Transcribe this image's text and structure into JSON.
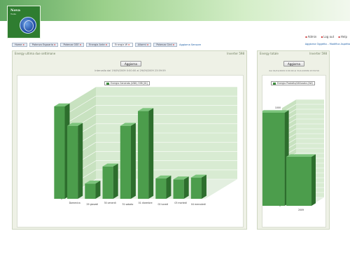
{
  "app": {
    "logo_title": "Nova",
    "logo_sub": "Tools"
  },
  "toplinks": [
    "Admin",
    "Log out",
    "Help"
  ],
  "tabs": [
    {
      "label": "Home",
      "active": false
    },
    {
      "label": "Potenza Espoaria",
      "active": false
    },
    {
      "label": "Potenza GSE",
      "active": false
    },
    {
      "label": "Energia Ante",
      "active": false
    },
    {
      "label": "Energia W",
      "active": true
    },
    {
      "label": "Allarmi",
      "active": false
    },
    {
      "label": "Potenza Gird",
      "active": false
    }
  ],
  "tab_extra": "Aggiorna Sensore",
  "tab_right": "Aggiorna Oggetto – Modifica Aspetto",
  "panels": [
    {
      "title": "Energy ultima due settimane",
      "right": "Inverter 598",
      "button": "Aggiorna",
      "subtitle": "Intervallo dal 19/09/2009 0:00:00 al 29/09/2009 23:59:59"
    },
    {
      "title": "Energy totale",
      "right": "Inverter 598",
      "button": "Aggiorna",
      "subtitle": "dal 01/01/2009 0:00:00 al 31/12/2009 23:59:59"
    }
  ],
  "colors": {
    "bar_front": "#4c9d4c",
    "bar_side": "#2d6e2d",
    "bar_top": "#7cc47c",
    "wall": "#d8ebd2"
  },
  "chart_data": [
    {
      "type": "bar",
      "title": "",
      "legend": "Energia Generata (kWh) 598 [Ut]",
      "xlabel": "",
      "ylabel": "",
      "ylim": [
        0,
        2000
      ],
      "yticks": [
        0,
        200,
        400,
        600,
        800,
        1000,
        1200,
        1400,
        1600,
        1800,
        2000
      ],
      "categories": [
        "Domenica",
        "29 giovedì",
        "30 venerdì",
        "31 sabato",
        "01 dicembre",
        "02 lunedì",
        "03 martedì",
        "04 mercoledì"
      ],
      "values": [
        1580,
        330,
        700,
        1580,
        1900,
        440,
        420,
        460
      ],
      "extra_first": 2000
    },
    {
      "type": "bar",
      "title": "",
      "legend": "Energia Prodotta/Utilizzata (kW)",
      "xlabel": "",
      "ylabel": "",
      "ylim": [
        0,
        1000
      ],
      "yticks": [
        0,
        50,
        100,
        150,
        200,
        250,
        300,
        350,
        400,
        450,
        500,
        550,
        600,
        650,
        700,
        750,
        800,
        850,
        900,
        950,
        1000
      ],
      "categories": [
        "2009"
      ],
      "values": [
        500
      ],
      "extra_first": 950
    }
  ]
}
